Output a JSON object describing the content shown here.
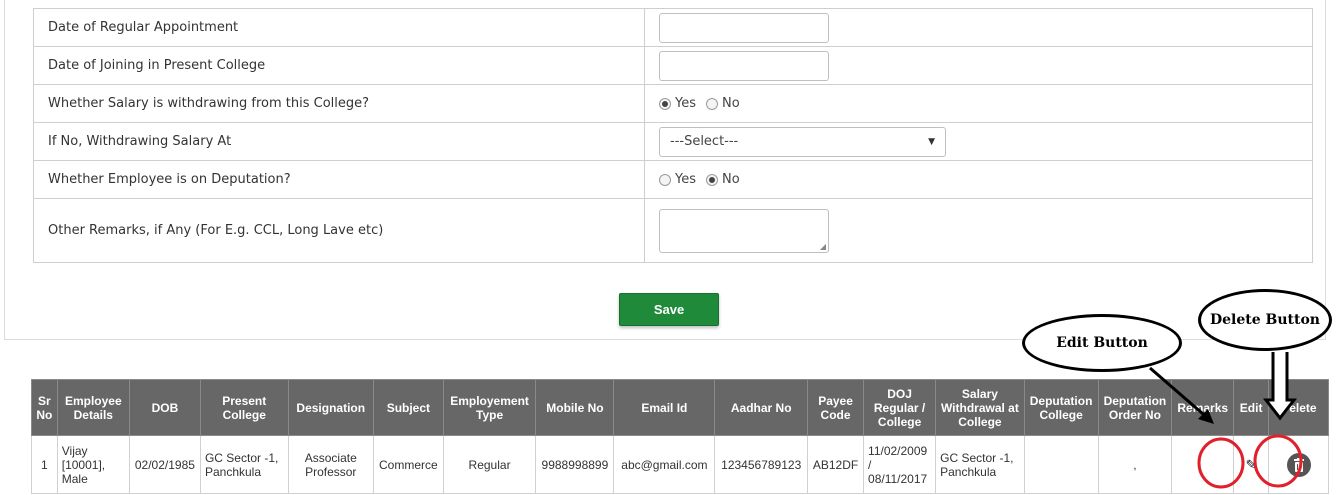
{
  "form": {
    "rows": [
      {
        "label": "Date of Regular Appointment"
      },
      {
        "label": "Date of Joining in Present College"
      },
      {
        "label": "Whether Salary is withdrawing from this College?",
        "yes": "Yes",
        "no": "No"
      },
      {
        "label": "If No, Withdrawing Salary At",
        "select_value": "---Select---"
      },
      {
        "label": "Whether Employee is on Deputation?",
        "yes": "Yes",
        "no": "No"
      },
      {
        "label": "Other Remarks, if Any (For E.g. CCL, Long Lave etc)"
      }
    ],
    "save_label": "Save"
  },
  "table": {
    "headers": {
      "sr": "Sr No",
      "emp": "Employee Details",
      "dob": "DOB",
      "college": "Present College",
      "desig": "Designation",
      "subject": "Subject",
      "emptype": "Employement Type",
      "mobile": "Mobile No",
      "email": "Email Id",
      "aadhar": "Aadhar No",
      "payee": "Payee Code",
      "doj": "DOJ Regular / College",
      "salary": "Salary Withdrawal at College",
      "dep_college": "Deputation College",
      "dep_order": "Deputation Order No",
      "remarks": "Remarks",
      "edit": "Edit",
      "delete": "Delete"
    },
    "row": {
      "sr": "1",
      "emp": "Vijay [10001], Male",
      "dob": "02/02/1985",
      "college": "GC Sector -1, Panchkula",
      "desig": "Associate Professor",
      "subject": "Commerce",
      "emptype": "Regular",
      "mobile": "9988998899",
      "email": "abc@gmail.com",
      "aadhar": "123456789123",
      "payee": "AB12DF",
      "doj": "11/02/2009 / 08/11/2017",
      "salary": "GC Sector -1, Panchkula",
      "dep_college": "",
      "dep_order": ",",
      "remarks": ""
    }
  },
  "annotations": {
    "edit": "Edit Button",
    "delete": "Delete Button"
  },
  "colors": {
    "save_button": "#1f8a3a",
    "table_header": "#676767",
    "highlight_circle": "#e0202a"
  },
  "icons": [
    "pencil-icon",
    "trash-icon"
  ]
}
